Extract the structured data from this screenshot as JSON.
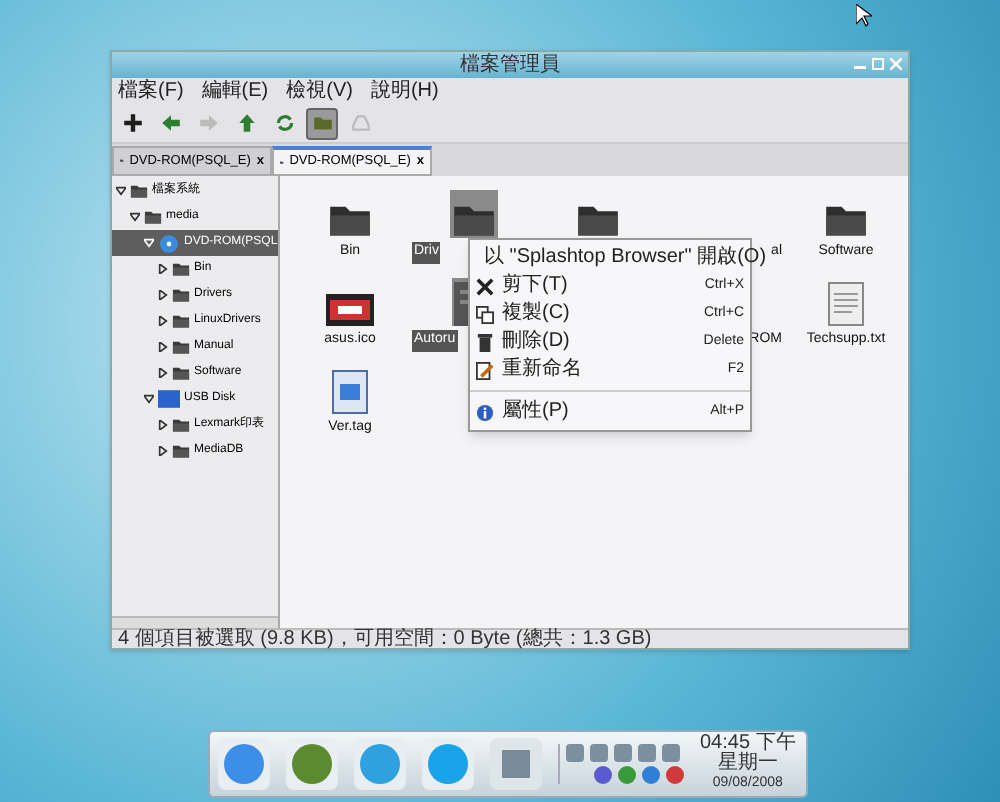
{
  "window": {
    "title": "檔案管理員"
  },
  "menu_bar": [
    {
      "label": "檔案(F)"
    },
    {
      "label": "編輯(E)"
    },
    {
      "label": "檢視(V)"
    },
    {
      "label": "說明(H)"
    }
  ],
  "toolbar": [
    {
      "disabled": false,
      "selected": false
    },
    {
      "disabled": false,
      "selected": false
    },
    {
      "disabled": true,
      "selected": false
    },
    {
      "disabled": false,
      "selected": false
    },
    {
      "disabled": false,
      "selected": false
    },
    {
      "disabled": false,
      "selected": true
    },
    {
      "disabled": true,
      "selected": false
    }
  ],
  "tabs": [
    {
      "label": "DVD-ROM(PSQL_E)",
      "close": "x",
      "selected": false
    },
    {
      "label": "DVD-ROM(PSQL_E)",
      "close": "x",
      "selected": true
    }
  ],
  "tree": [
    {
      "label": "檔案系統",
      "kind": "folder",
      "expanded": true,
      "selected": false,
      "children": [
        {
          "label": "media",
          "kind": "folder",
          "expanded": true,
          "selected": false,
          "children": [
            {
              "label": "DVD-ROM(PSQL",
              "kind": "disc",
              "expanded": true,
              "selected": true,
              "children": [
                {
                  "label": "Bin",
                  "kind": "folder",
                  "expanded": false,
                  "selected": false
                },
                {
                  "label": "Drivers",
                  "kind": "folder",
                  "expanded": false,
                  "selected": false
                },
                {
                  "label": "LinuxDrivers",
                  "kind": "folder",
                  "expanded": false,
                  "selected": false
                },
                {
                  "label": "Manual",
                  "kind": "folder",
                  "expanded": false,
                  "selected": false
                },
                {
                  "label": "Software",
                  "kind": "folder",
                  "expanded": false,
                  "selected": false
                }
              ]
            },
            {
              "label": "USB Disk",
              "kind": "usb",
              "expanded": true,
              "selected": false,
              "children": [
                {
                  "label": "Lexmark印表",
                  "kind": "folder",
                  "expanded": false,
                  "selected": false
                },
                {
                  "label": "MediaDB",
                  "kind": "folder",
                  "expanded": false,
                  "selected": false
                }
              ]
            }
          ]
        }
      ]
    }
  ],
  "files": [
    {
      "label": "Bin",
      "kind": "folder",
      "selected": false
    },
    {
      "label": "Driv",
      "kind": "folder",
      "selected": true,
      "cut_end": true
    },
    {
      "kind": "folder",
      "selected": false
    },
    {
      "label": "al",
      "kind": "hidden",
      "selected": false,
      "cut_start": true
    },
    {
      "label": "Software",
      "kind": "folder",
      "selected": false
    },
    {
      "label": "asus.ico",
      "kind": "image",
      "selected": false
    },
    {
      "label": "Autoru",
      "kind": "program",
      "selected": true,
      "cut_end": true
    },
    {
      "kind": "hidden"
    },
    {
      "label": "ROM",
      "kind": "hidden",
      "selected": false,
      "cut_start": true
    },
    {
      "label": "Techsupp.txt",
      "kind": "document",
      "selected": false
    },
    {
      "label": "Ver.tag",
      "kind": "tag",
      "selected": false
    }
  ],
  "context_menu": [
    {
      "kind": "item",
      "label": "以 \"Splashtop Browser\" 開啟(O)"
    },
    {
      "kind": "item",
      "label": "剪下(T)",
      "shortcut": "Ctrl+X"
    },
    {
      "kind": "item",
      "label": "複製(C)",
      "shortcut": "Ctrl+C"
    },
    {
      "kind": "item",
      "label": "刪除(D)",
      "shortcut": "Delete"
    },
    {
      "kind": "item",
      "label": "重新命名",
      "shortcut": "F2"
    },
    {
      "kind": "separator"
    },
    {
      "kind": "item",
      "label": "屬性(P)",
      "shortcut": "Alt+P"
    }
  ],
  "status_bar": "4 個項目被選取 (9.8 KB)，可用空間：0 Byte (總共：1.3 GB)",
  "taskbar": {
    "clock": {
      "time": "04:45 下午",
      "day": "星期一",
      "date": "09/08/2008"
    }
  }
}
